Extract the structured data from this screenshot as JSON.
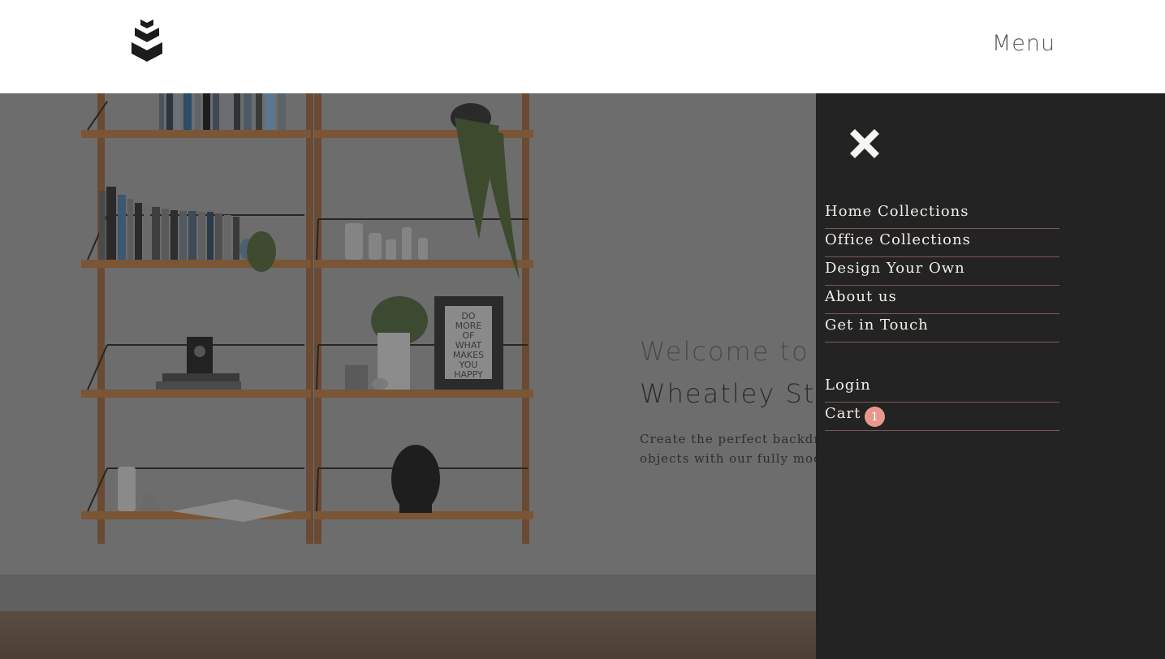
{
  "header": {
    "menu_label": "Menu",
    "logo_icon": "stacked-chevrons-logo"
  },
  "hero": {
    "title_line1": "Welcome to",
    "title_line2": "Wheatley Stu",
    "desc_line1": "Create the perfect backdrop",
    "desc_line2": "objects with our fully modul",
    "poster_lines": [
      "DO",
      "MORE",
      "OF",
      "WHAT",
      "MAKES",
      "YOU",
      "HAPPY"
    ]
  },
  "side_menu": {
    "close_icon": "close-x-icon",
    "items": [
      {
        "label": "Home Collections"
      },
      {
        "label": "Office Collections"
      },
      {
        "label": "Design Your Own"
      },
      {
        "label": "About us"
      },
      {
        "label": "Get in Touch"
      }
    ],
    "account": {
      "login_label": "Login",
      "cart_label": "Cart",
      "cart_count": "1"
    }
  },
  "colors": {
    "panel_bg": "#232323",
    "divider": "#7a5a56",
    "badge": "#e8978c",
    "menu_text": "#f2efe6"
  }
}
